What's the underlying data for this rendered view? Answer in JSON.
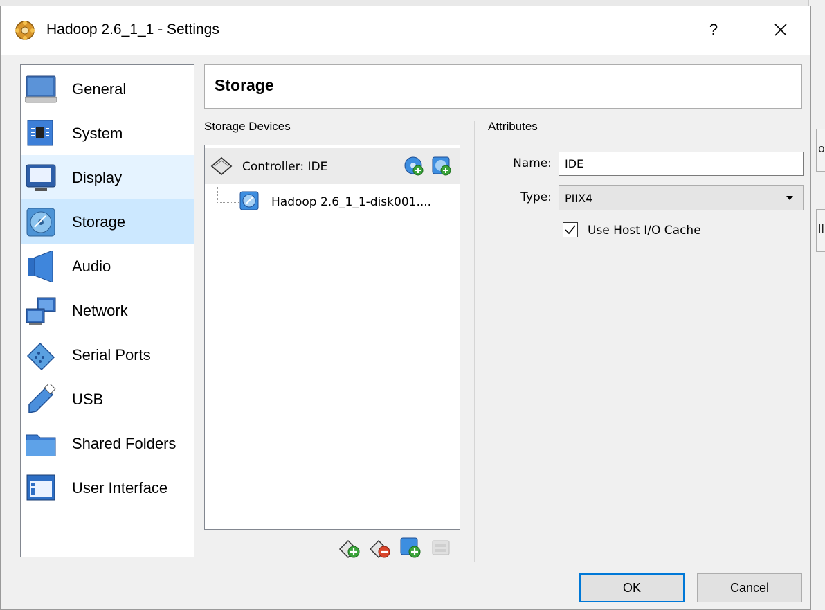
{
  "window": {
    "title": "Hadoop 2.6_1_1 - Settings",
    "help_label": "?",
    "app_icon": "virtualbox-settings-icon",
    "close_icon": "close-icon"
  },
  "sidebar": {
    "items": [
      {
        "label": "General",
        "icon": "general-monitor-icon"
      },
      {
        "label": "System",
        "icon": "system-chip-icon"
      },
      {
        "label": "Display",
        "icon": "display-screen-icon"
      },
      {
        "label": "Storage",
        "icon": "storage-disk-icon",
        "selected": true
      },
      {
        "label": "Audio",
        "icon": "audio-speaker-icon"
      },
      {
        "label": "Network",
        "icon": "network-icon"
      },
      {
        "label": "Serial Ports",
        "icon": "serial-port-icon"
      },
      {
        "label": "USB",
        "icon": "usb-icon"
      },
      {
        "label": "Shared Folders",
        "icon": "shared-folder-icon"
      },
      {
        "label": "User Interface",
        "icon": "user-interface-icon"
      }
    ]
  },
  "page": {
    "title": "Storage"
  },
  "storage_devices": {
    "label": "Storage Devices",
    "controller": {
      "label": "Controller: IDE"
    },
    "disk": {
      "label": "Hadoop 2.6_1_1-disk001...."
    }
  },
  "attributes": {
    "label": "Attributes",
    "name_label": "Name:",
    "name_value": "IDE",
    "type_label": "Type:",
    "type_value": "PIIX4",
    "host_cache_label": "Use Host I/O Cache",
    "host_cache_checked": true
  },
  "buttons": {
    "ok": "OK",
    "cancel": "Cancel"
  },
  "background_window": {
    "fragments": [
      "ov",
      "ll"
    ]
  },
  "colors": {
    "selection": "#cce8ff",
    "hover": "#e5f3ff",
    "accent": "#0078d7"
  }
}
